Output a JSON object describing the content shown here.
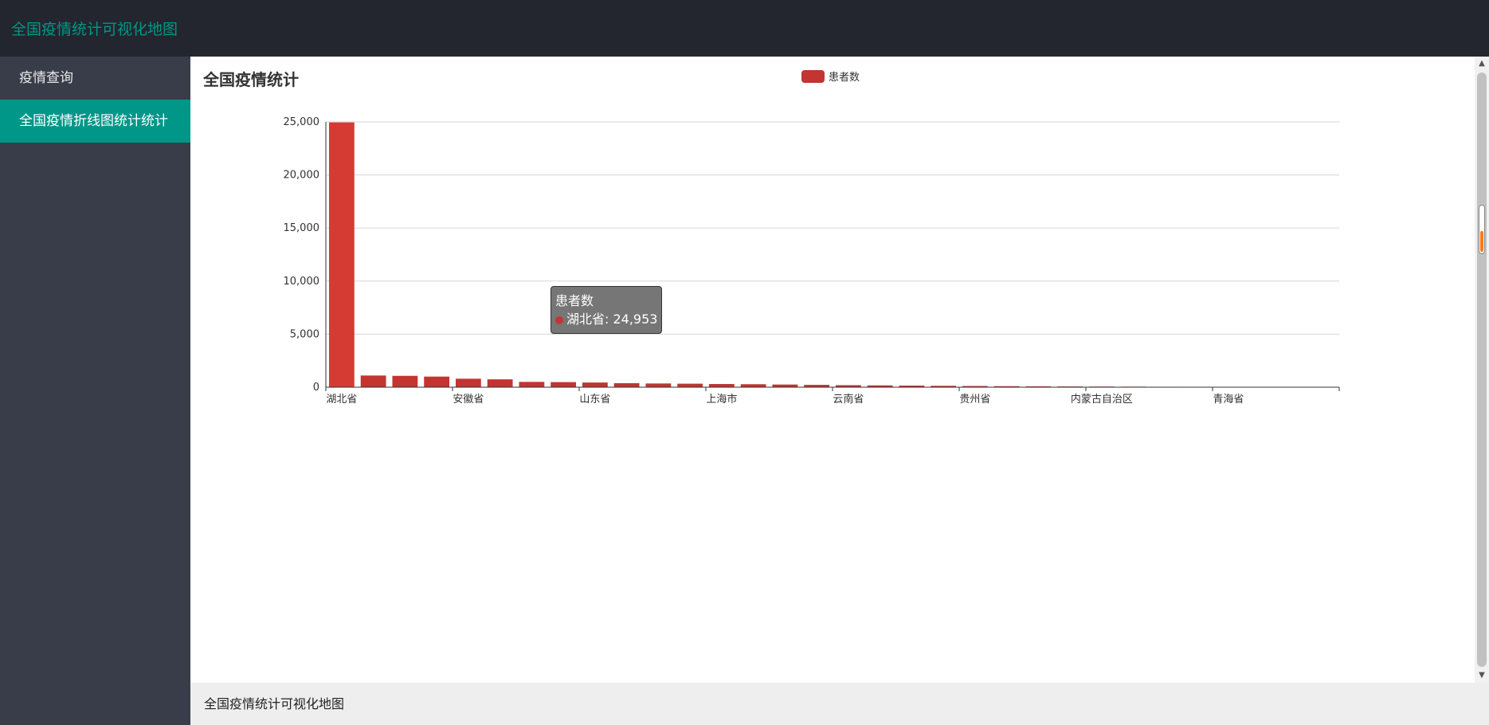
{
  "app": {
    "title": "全国疫情统计可视化地图"
  },
  "sidebar": {
    "items": [
      {
        "label": "疫情查询",
        "active": false
      },
      {
        "label": "全国疫情折线图统计统计",
        "active": true
      }
    ]
  },
  "footer": {
    "text": "全国疫情统计可视化地图"
  },
  "colors": {
    "accent": "#009688",
    "bar": "#c23531",
    "header_bg": "#23262e",
    "sidebar_bg": "#393d49"
  },
  "chart_data": {
    "type": "bar",
    "title": "全国疫情统计",
    "legend": [
      "患者数"
    ],
    "legend_position": "top-center",
    "grid": true,
    "ylim": [
      0,
      25000
    ],
    "yticks": [
      "25,000",
      "20,000",
      "15,000",
      "10,000",
      "5,000",
      "0"
    ],
    "categories": [
      "湖北省",
      "",
      "",
      "",
      "安徽省",
      "",
      "",
      "",
      "山东省",
      "",
      "",
      "",
      "上海市",
      "",
      "",
      "",
      "云南省",
      "",
      "",
      "",
      "贵州省",
      "",
      "",
      "",
      "内蒙古自治区",
      "",
      "",
      "",
      "青海省",
      "",
      "",
      ""
    ],
    "series": [
      {
        "name": "患者数",
        "values": [
          24953,
          1100,
          1070,
          1000,
          800,
          740,
          500,
          480,
          440,
          380,
          350,
          330,
          300,
          280,
          250,
          220,
          190,
          170,
          150,
          130,
          110,
          95,
          80,
          70,
          60,
          50,
          40,
          30,
          20,
          10,
          5,
          3
        ]
      }
    ]
  },
  "tooltip": {
    "series": "患者数",
    "item": "湖北省: 24,953"
  }
}
